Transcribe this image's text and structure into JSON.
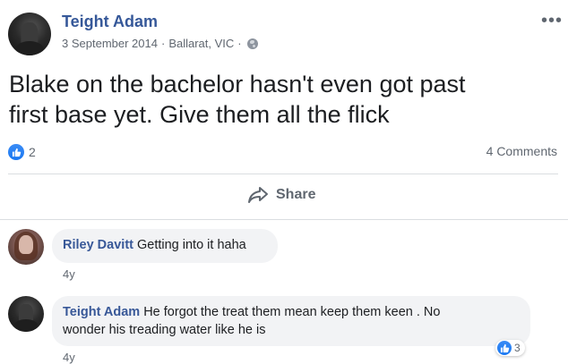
{
  "post": {
    "author": "Teight Adam",
    "date": "3 September 2014",
    "separator": "·",
    "location": "Ballarat, VIC",
    "separator2": "·",
    "text_line1": "Blake on the bachelor hasn't even got past",
    "text_line2": "first base yet. Give them all the flick",
    "like_count": "2",
    "comments_count": "4 Comments",
    "share_label": "Share",
    "more_icon": "ellipsis-icon",
    "privacy_icon": "globe-icon"
  },
  "comments": [
    {
      "author": "Riley Davitt",
      "text": "Getting into it haha",
      "time": "4y"
    },
    {
      "author": "Teight Adam",
      "text_line1": "He forgot the treat them mean keep them keen . No",
      "text_line2": "wonder his treading water like he is",
      "time": "4y",
      "reaction_count": "3"
    }
  ],
  "colors": {
    "link_blue": "#365899",
    "like_blue": "#1877f2",
    "meta_gray": "#606770",
    "bubble_bg": "#f2f3f5",
    "divider": "#dadde1"
  }
}
